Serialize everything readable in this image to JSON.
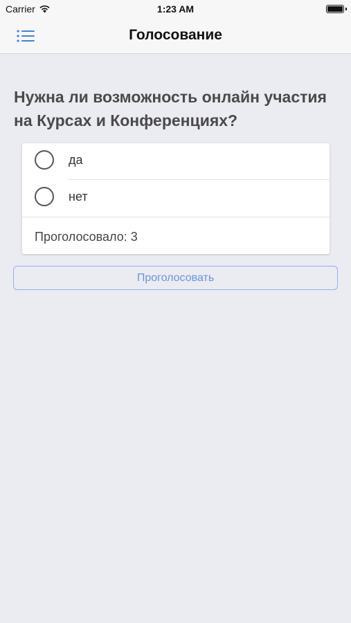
{
  "status_bar": {
    "carrier": "Carrier",
    "time": "1:23 AM",
    "battery_level": 1.0
  },
  "nav": {
    "title": "Голосование",
    "menu_icon": "list-menu-icon",
    "accent_color": "#3b82e6"
  },
  "poll": {
    "question": "Нужна ли возможность онлайн участия на Курсах и Конференциях?",
    "options": [
      {
        "label": "да",
        "selected": false
      },
      {
        "label": "нет",
        "selected": false
      }
    ],
    "vote_count_text": "Проголосовало: 3"
  },
  "actions": {
    "vote_button_label": "Проголосовать"
  }
}
